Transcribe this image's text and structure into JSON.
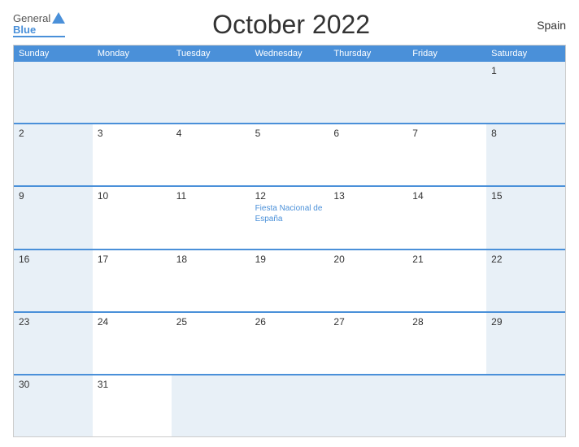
{
  "header": {
    "title": "October 2022",
    "country": "Spain",
    "logo": {
      "general": "General",
      "blue": "Blue"
    }
  },
  "calendar": {
    "dayHeaders": [
      "Sunday",
      "Monday",
      "Tuesday",
      "Wednesday",
      "Thursday",
      "Friday",
      "Saturday"
    ],
    "weeks": [
      [
        {
          "day": "",
          "empty": true
        },
        {
          "day": "",
          "empty": true
        },
        {
          "day": "",
          "empty": true
        },
        {
          "day": "",
          "empty": true
        },
        {
          "day": "",
          "empty": true
        },
        {
          "day": "",
          "empty": true
        },
        {
          "day": "1",
          "saturday": true
        }
      ],
      [
        {
          "day": "2",
          "sunday": true
        },
        {
          "day": "3"
        },
        {
          "day": "4"
        },
        {
          "day": "5"
        },
        {
          "day": "6"
        },
        {
          "day": "7"
        },
        {
          "day": "8",
          "saturday": true
        }
      ],
      [
        {
          "day": "9",
          "sunday": true
        },
        {
          "day": "10"
        },
        {
          "day": "11"
        },
        {
          "day": "12",
          "event": "Fiesta Nacional de España"
        },
        {
          "day": "13"
        },
        {
          "day": "14"
        },
        {
          "day": "15",
          "saturday": true
        }
      ],
      [
        {
          "day": "16",
          "sunday": true
        },
        {
          "day": "17"
        },
        {
          "day": "18"
        },
        {
          "day": "19"
        },
        {
          "day": "20"
        },
        {
          "day": "21"
        },
        {
          "day": "22",
          "saturday": true
        }
      ],
      [
        {
          "day": "23",
          "sunday": true
        },
        {
          "day": "24"
        },
        {
          "day": "25"
        },
        {
          "day": "26"
        },
        {
          "day": "27"
        },
        {
          "day": "28"
        },
        {
          "day": "29",
          "saturday": true
        }
      ],
      [
        {
          "day": "30",
          "sunday": true
        },
        {
          "day": "31"
        },
        {
          "day": "",
          "empty": true
        },
        {
          "day": "",
          "empty": true
        },
        {
          "day": "",
          "empty": true
        },
        {
          "day": "",
          "empty": true
        },
        {
          "day": "",
          "empty": true,
          "saturday": true
        }
      ]
    ]
  }
}
